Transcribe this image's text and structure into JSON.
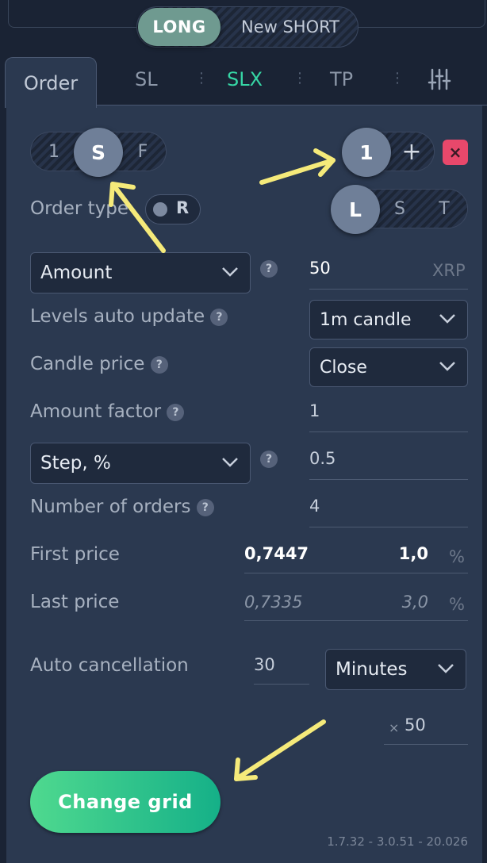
{
  "side_toggle": {
    "long_label": "LONG",
    "short_label": "New SHORT"
  },
  "tabs": [
    {
      "label": "Order",
      "active": false
    },
    {
      "label": "SL",
      "active": false
    },
    {
      "label": "SLX",
      "active": true
    },
    {
      "label": "TP",
      "active": false
    }
  ],
  "settings_icon": "sliders-icon",
  "mode_selector": {
    "left": "1",
    "selected": "S",
    "right": "F"
  },
  "count_selector": {
    "value": "1",
    "plus": "+"
  },
  "lst_selector": {
    "selected": "L",
    "s": "S",
    "t": "T"
  },
  "order_type": {
    "label": "Order type",
    "toggle_label": "R"
  },
  "amount": {
    "select": "Amount",
    "value": "50",
    "unit": "XRP"
  },
  "levels_auto_update": {
    "label": "Levels auto update",
    "value": "1m candle"
  },
  "candle_price": {
    "label": "Candle price",
    "value": "Close"
  },
  "amount_factor": {
    "label": "Amount factor",
    "value": "1"
  },
  "step": {
    "select": "Step, %",
    "value": "0.5"
  },
  "number_of_orders": {
    "label": "Number of orders",
    "value": "4"
  },
  "first_price": {
    "label": "First price",
    "price": "0,7447",
    "percent": "1,0",
    "unit": "%"
  },
  "last_price": {
    "label": "Last price",
    "price": "0,7335",
    "percent": "3,0",
    "unit": "%"
  },
  "auto_cancellation": {
    "label": "Auto cancellation",
    "value": "30",
    "unit": "Minutes"
  },
  "multiplier": {
    "prefix": "×",
    "value": "50"
  },
  "help_glyph": "?",
  "close_glyph": "×",
  "cta": {
    "label": "Change grid"
  },
  "version": "1.7.32 - 3.0.51 - 20.026",
  "colors": {
    "accent": "#36d6a5",
    "cta_start": "#4fd98f",
    "cta_end": "#15b088",
    "danger": "#e8486b",
    "annotation": "#f5ea7a"
  }
}
